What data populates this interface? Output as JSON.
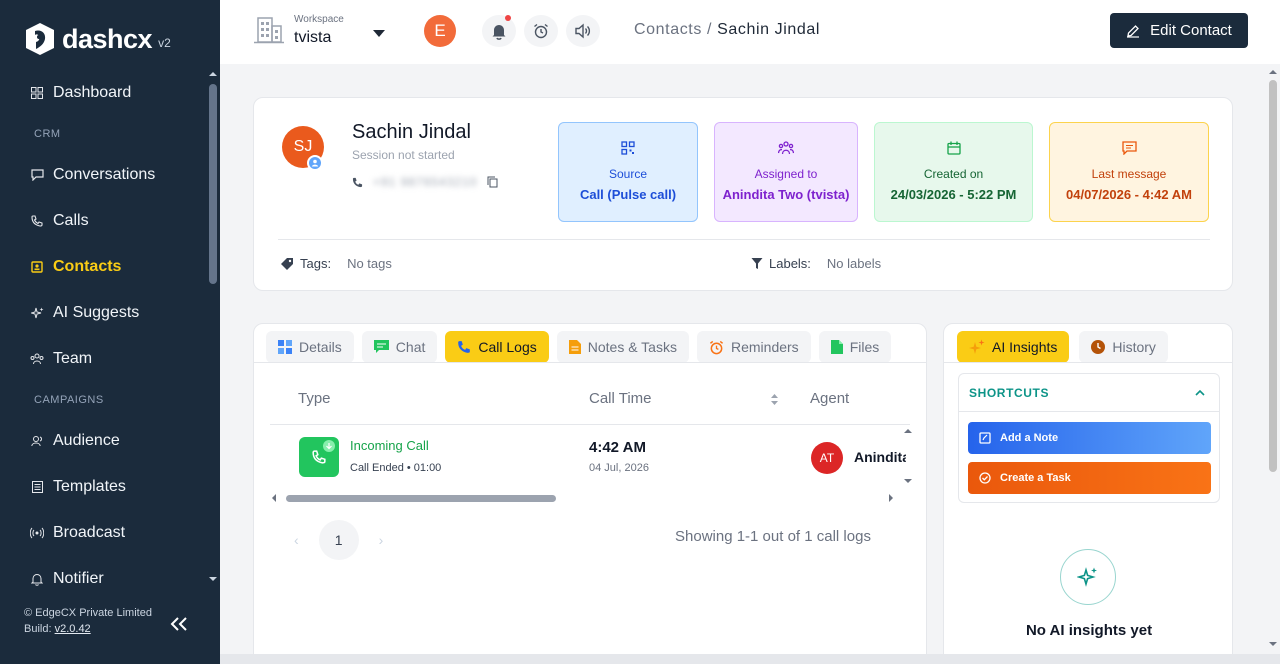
{
  "brand": {
    "name": "dashcx",
    "version": "v2"
  },
  "sidebar": {
    "items": [
      {
        "label": "Dashboard",
        "icon": "dashboard-icon"
      },
      {
        "section": "CRM"
      },
      {
        "label": "Conversations",
        "icon": "chat-icon"
      },
      {
        "label": "Calls",
        "icon": "phone-icon"
      },
      {
        "label": "Contacts",
        "icon": "contacts-icon",
        "active": true
      },
      {
        "label": "AI Suggests",
        "icon": "sparkle-icon"
      },
      {
        "label": "Team",
        "icon": "team-icon"
      },
      {
        "section": "CAMPAIGNS"
      },
      {
        "label": "Audience",
        "icon": "audience-icon"
      },
      {
        "label": "Templates",
        "icon": "template-icon"
      },
      {
        "label": "Broadcast",
        "icon": "broadcast-icon"
      },
      {
        "label": "Notifier",
        "icon": "bell-icon"
      }
    ],
    "footer": {
      "company": "© EdgeCX Private Limited",
      "build_label": "Build:",
      "build": "v2.0.42"
    }
  },
  "topbar": {
    "workspace_caption": "Workspace",
    "workspace_name": "tvista",
    "user_initial": "E",
    "breadcrumb_parent": "Contacts",
    "breadcrumb_sep": " / ",
    "breadcrumb_current": "Sachin Jindal",
    "edit_button": "Edit Contact"
  },
  "contact": {
    "initials": "SJ",
    "name": "Sachin Jindal",
    "session_status": "Session not started",
    "phone_masked": "+91 9876543210",
    "info_boxes": [
      {
        "label": "Source",
        "value": "Call (Pulse call)",
        "bg": "#e0efff",
        "border": "#93c5fd",
        "color": "#1d4ed8",
        "icon": "qr-icon"
      },
      {
        "label": "Assigned to",
        "value": "Anindita Two (tvista)",
        "bg": "#f3e8ff",
        "border": "#d8b4fe",
        "color": "#7e22ce",
        "icon": "people-icon"
      },
      {
        "label": "Created on",
        "value": "24/03/2026 - 5:22 PM",
        "bg": "#e7f8ec",
        "border": "#bbf7d0",
        "color": "#166534",
        "icon": "calendar-icon"
      },
      {
        "label": "Last message",
        "value": "04/07/2026 - 4:42 AM",
        "bg": "#fff4e0",
        "border": "#fcd34d",
        "color": "#c2410c",
        "icon": "message-icon"
      }
    ],
    "tags_label": "Tags:",
    "tags_value": "No tags",
    "labels_label": "Labels:",
    "labels_value": "No labels"
  },
  "tabs": [
    {
      "label": "Details"
    },
    {
      "label": "Chat"
    },
    {
      "label": "Call Logs",
      "active": true
    },
    {
      "label": "Notes & Tasks"
    },
    {
      "label": "Reminders"
    },
    {
      "label": "Files"
    }
  ],
  "call_logs": {
    "headers": {
      "type": "Type",
      "time": "Call Time",
      "agent": "Agent"
    },
    "rows": [
      {
        "type": "Incoming Call",
        "status": "Call Ended • 01:00",
        "time": "4:42 AM",
        "date": "04 Jul, 2026",
        "agent_initials": "AT",
        "agent_name": "Anindita Two"
      }
    ],
    "page": "1",
    "prev": "‹",
    "next": "›",
    "showing": "Showing 1-1 out of 1 call logs"
  },
  "ai_panel": {
    "tabs": [
      {
        "label": "AI Insights",
        "active": true
      },
      {
        "label": "History"
      }
    ],
    "shortcuts_title": "SHORTCUTS",
    "add_note": "Add a Note",
    "create_task": "Create a Task",
    "empty": "No AI insights yet"
  },
  "colors": {
    "sidebar": "#1b2b3c",
    "accent": "#facc15",
    "brand_orange": "#ea5a1d"
  }
}
